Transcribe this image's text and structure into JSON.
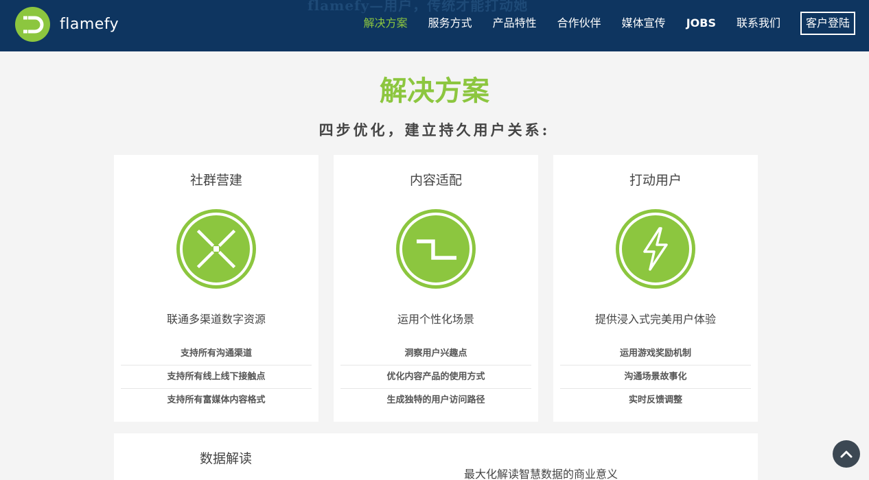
{
  "header": {
    "ghost_text": "flamefy—用户，传统才能打动她",
    "logo_text": "flamefy",
    "nav": [
      "解决方案",
      "服务方式",
      "产品特性",
      "合作伙伴",
      "媒体宣传",
      "JOBS",
      "联系我们"
    ],
    "login_label": "客户登陆"
  },
  "main": {
    "title": "解决方案",
    "subtitle": "四步优化，建立持久用户关系:"
  },
  "cards": [
    {
      "title": "社群营建",
      "icon": "community-cross-icon",
      "desc": "联通多渠道数字资源",
      "items": [
        "支持所有沟通渠道",
        "支持所有线上线下接触点",
        "支持所有富媒体内容格式"
      ]
    },
    {
      "title": "内容适配",
      "icon": "content-adapt-icon",
      "desc": "运用个性化场景",
      "items": [
        "洞察用户兴趣点",
        "优化内容产品的使用方式",
        "生成独特的用户访问路径"
      ]
    },
    {
      "title": "打动用户",
      "icon": "lightning-icon",
      "desc": "提供浸入式完美用户体验",
      "items": [
        "运用游戏奖励机制",
        "沟通场景故事化",
        "实时反馈调整"
      ]
    }
  ],
  "card4": {
    "title": "数据解读",
    "desc": "最大化解读智慧数据的商业意义"
  },
  "colors": {
    "accent": "#8cc63f",
    "navbar": "#0e3560",
    "background": "#f4f4f4"
  }
}
